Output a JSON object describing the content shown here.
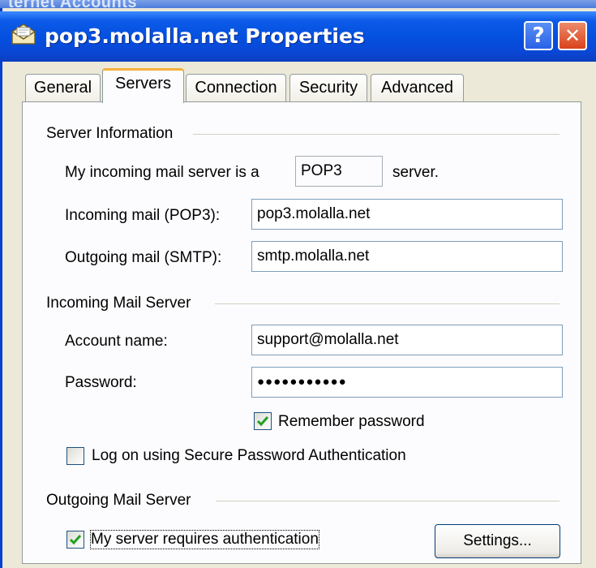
{
  "background_window": {
    "title": "ternet Accounts"
  },
  "dialog": {
    "title": "pop3.molalla.net Properties",
    "help_glyph": "?",
    "close_glyph": "✕"
  },
  "tabs": [
    {
      "label": "General",
      "active": false
    },
    {
      "label": "Servers",
      "active": true
    },
    {
      "label": "Connection",
      "active": false
    },
    {
      "label": "Security",
      "active": false
    },
    {
      "label": "Advanced",
      "active": false
    }
  ],
  "server_information": {
    "heading": "Server Information",
    "incoming_prefix": "My incoming mail server is a",
    "server_type": "POP3",
    "incoming_suffix": "server.",
    "incoming_label": "Incoming mail (POP3):",
    "incoming_value": "pop3.molalla.net",
    "outgoing_label": "Outgoing mail (SMTP):",
    "outgoing_value": "smtp.molalla.net"
  },
  "incoming_mail_server": {
    "heading": "Incoming Mail Server",
    "account_label": "Account name:",
    "account_value": "support@molalla.net",
    "password_label": "Password:",
    "password_value": "●●●●●●●●●●●",
    "remember_label": "Remember password",
    "remember_checked": true,
    "spa_label": "Log on using Secure Password Authentication",
    "spa_checked": false
  },
  "outgoing_mail_server": {
    "heading": "Outgoing Mail Server",
    "auth_label": "My server requires authentication",
    "auth_checked": true,
    "settings_button": "Settings..."
  },
  "colors": {
    "titlebar": "#0450e0",
    "dialog_face": "#ece9d8",
    "checkmark": "#21a121",
    "tab_highlight": "#f5b03c"
  }
}
